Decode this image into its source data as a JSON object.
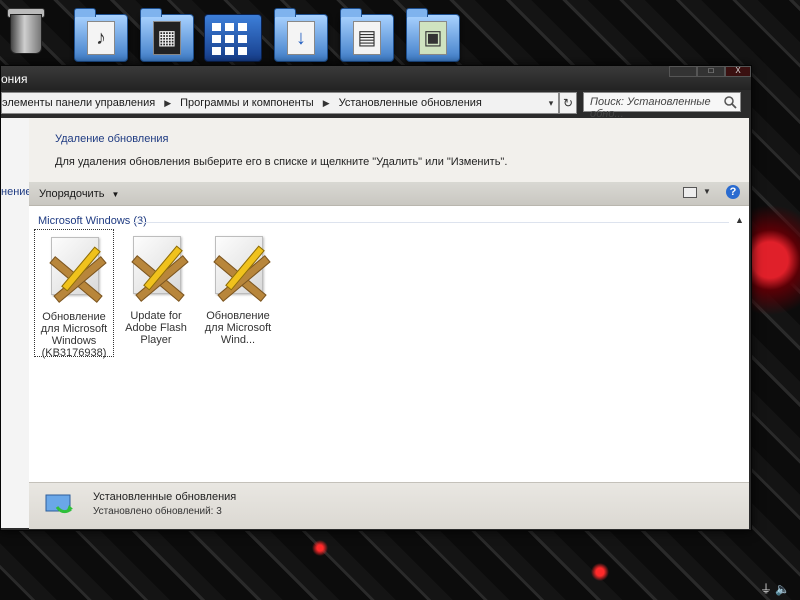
{
  "window": {
    "title": "ония",
    "min_label": "□",
    "max_label": "□",
    "close_label": "X"
  },
  "address": {
    "crumbs": [
      "элементы панели управления",
      "Программы и компоненты",
      "Установленные обновления"
    ],
    "separator": "▶"
  },
  "search": {
    "placeholder": "Поиск: Установленные обно..."
  },
  "nav": {
    "fragment": "нение"
  },
  "info": {
    "title": "Удаление обновления",
    "description": "Для удаления обновления выберите его в списке и щелкните \"Удалить\" или \"Изменить\"."
  },
  "toolbar": {
    "organize_label": "Упорядочить",
    "help_label": "?"
  },
  "group": {
    "header": "Microsoft Windows (3)"
  },
  "items": [
    {
      "label": "Обновление для Microsoft Windows (KB3176938)"
    },
    {
      "label": "Update for Adobe Flash Player"
    },
    {
      "label": "Обновление для Microsoft Wind..."
    }
  ],
  "details": {
    "title": "Установленные обновления",
    "subtitle": "Установлено обновлений: 3"
  },
  "dock": {
    "icons": [
      "trash-icon",
      "music-folder-icon",
      "video-folder-icon",
      "applications-icon",
      "downloads-folder-icon",
      "documents-folder-icon",
      "pictures-folder-icon"
    ]
  },
  "colors": {
    "link_blue": "#1f3b82",
    "help_blue": "#2a6bd0",
    "accent_red": "#e0202a"
  }
}
